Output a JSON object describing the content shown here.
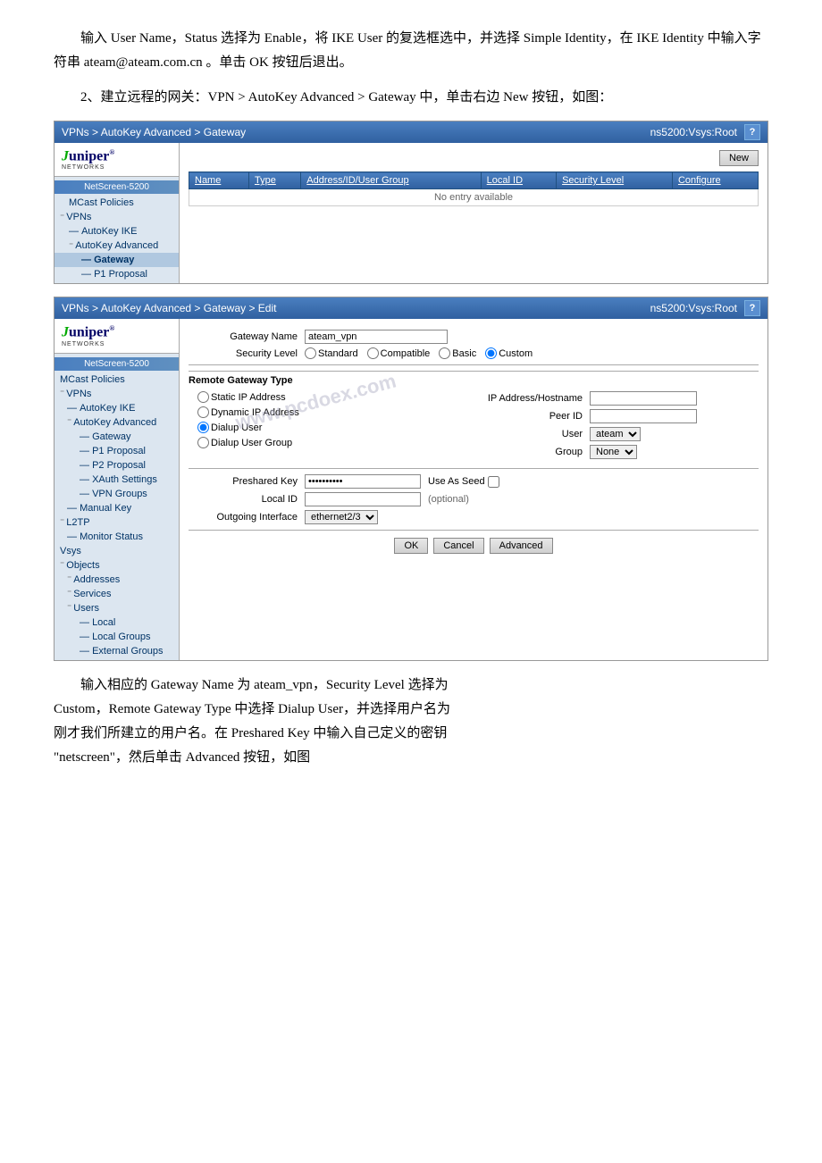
{
  "page": {
    "para1": "输入 User Name，Status 选择为 Enable，将 IKE User 的复选框选中，并选择 Simple Identity，在 IKE Identity 中输入字符串 ateam@ateam.com.cn 。单击 OK 按钮后退出。",
    "para2": "2、建立远程的网关：VPN > AutoKey Advanced > Gateway 中，单击右边 New 按钮，如图："
  },
  "screen1": {
    "topbar_path": "VPNs > AutoKey Advanced > Gateway",
    "topbar_server": "ns5200:Vsys:Root",
    "help_label": "?",
    "new_button": "New",
    "table": {
      "headers": [
        "Name",
        "Type",
        "Address/ID/User Group",
        "Local ID",
        "Security Level",
        "Configure"
      ],
      "no_entry": "No entry available"
    },
    "sidebar": {
      "device": "NetScreen-5200",
      "items": [
        {
          "label": "MCast Policies",
          "indent": 0,
          "expand": false
        },
        {
          "label": "VPNs",
          "indent": 0,
          "expand": true
        },
        {
          "label": "AutoKey IKE",
          "indent": 1,
          "expand": false
        },
        {
          "label": "AutoKey Advanced",
          "indent": 1,
          "expand": true
        },
        {
          "label": "Gateway",
          "indent": 2,
          "expand": false,
          "selected": true
        },
        {
          "label": "P1 Proposal",
          "indent": 2,
          "expand": false
        }
      ]
    }
  },
  "screen2": {
    "topbar_path": "VPNs > AutoKey Advanced > Gateway > Edit",
    "topbar_server": "ns5200:Vsys:Root",
    "help_label": "?",
    "form": {
      "gateway_name_label": "Gateway Name",
      "gateway_name_value": "ateam_vpn",
      "security_level_label": "Security Level",
      "security_level_options": [
        "Standard",
        "Compatible",
        "Basic",
        "Custom"
      ],
      "security_level_selected": "Custom",
      "remote_gateway_type_label": "Remote Gateway Type",
      "static_ip_label": "Static IP Address",
      "ip_hostname_label": "IP Address/Hostname",
      "ip_hostname_value": "",
      "dynamic_ip_label": "Dynamic IP Address",
      "peer_id_label": "Peer ID",
      "peer_id_value": "",
      "dialup_user_label": "Dialup User",
      "user_label": "User",
      "user_value": "ateam",
      "dialup_user_group_label": "Dialup User Group",
      "group_label": "Group",
      "group_value": "None",
      "preshared_key_label": "Preshared Key",
      "preshared_key_value": "**********",
      "use_as_seed_label": "Use As Seed",
      "local_id_label": "Local ID",
      "local_id_value": "",
      "local_id_optional": "(optional)",
      "outgoing_interface_label": "Outgoing Interface",
      "outgoing_interface_value": "ethernet2/3",
      "ok_button": "OK",
      "cancel_button": "Cancel",
      "advanced_button": "Advanced"
    },
    "sidebar": {
      "device": "NetScreen-5200",
      "items": [
        {
          "label": "MCast Policies",
          "indent": 0,
          "expand": false
        },
        {
          "label": "VPNs",
          "indent": 0,
          "expand": true
        },
        {
          "label": "AutoKey IKE",
          "indent": 1,
          "expand": false
        },
        {
          "label": "AutoKey Advanced",
          "indent": 1,
          "expand": true
        },
        {
          "label": "Gateway",
          "indent": 2,
          "expand": false
        },
        {
          "label": "P1 Proposal",
          "indent": 2,
          "expand": false
        },
        {
          "label": "P2 Proposal",
          "indent": 2,
          "expand": false
        },
        {
          "label": "XAuth Settings",
          "indent": 2,
          "expand": false
        },
        {
          "label": "VPN Groups",
          "indent": 2,
          "expand": false
        },
        {
          "label": "Manual Key",
          "indent": 1,
          "expand": false
        },
        {
          "label": "L2TP",
          "indent": 0,
          "expand": true
        },
        {
          "label": "Monitor Status",
          "indent": 1,
          "expand": false
        },
        {
          "label": "Vsys",
          "indent": 0,
          "expand": false
        },
        {
          "label": "Objects",
          "indent": 0,
          "expand": true
        },
        {
          "label": "Addresses",
          "indent": 1,
          "expand": true
        },
        {
          "label": "Services",
          "indent": 1,
          "expand": true
        },
        {
          "label": "Users",
          "indent": 1,
          "expand": true
        },
        {
          "label": "Local",
          "indent": 2,
          "expand": false
        },
        {
          "label": "Local Groups",
          "indent": 2,
          "expand": false
        },
        {
          "label": "External Groups",
          "indent": 2,
          "expand": false
        }
      ]
    }
  },
  "para3_line1": "输入相应的 Gateway Name 为 ateam_vpn，Security Level 选择为",
  "para3_line2": "Custom，Remote Gateway Type 中选择 Dialup User，并选择用户名为",
  "para3_line3": "刚才我们所建立的用户名。在 Preshared Key 中输入自己定义的密钥",
  "para3_line4": "\"netscreen\"，然后单击 Advanced 按钮，如图"
}
